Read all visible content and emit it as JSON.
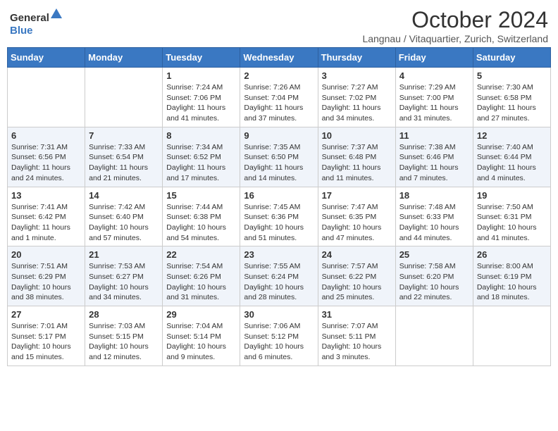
{
  "header": {
    "logo": {
      "general": "General",
      "blue": "Blue"
    },
    "title": "October 2024",
    "subtitle": "Langnau / Vitaquartier, Zurich, Switzerland"
  },
  "weekdays": [
    "Sunday",
    "Monday",
    "Tuesday",
    "Wednesday",
    "Thursday",
    "Friday",
    "Saturday"
  ],
  "weeks": [
    [
      null,
      null,
      {
        "day": "1",
        "sunrise": "Sunrise: 7:24 AM",
        "sunset": "Sunset: 7:06 PM",
        "daylight": "Daylight: 11 hours and 41 minutes."
      },
      {
        "day": "2",
        "sunrise": "Sunrise: 7:26 AM",
        "sunset": "Sunset: 7:04 PM",
        "daylight": "Daylight: 11 hours and 37 minutes."
      },
      {
        "day": "3",
        "sunrise": "Sunrise: 7:27 AM",
        "sunset": "Sunset: 7:02 PM",
        "daylight": "Daylight: 11 hours and 34 minutes."
      },
      {
        "day": "4",
        "sunrise": "Sunrise: 7:29 AM",
        "sunset": "Sunset: 7:00 PM",
        "daylight": "Daylight: 11 hours and 31 minutes."
      },
      {
        "day": "5",
        "sunrise": "Sunrise: 7:30 AM",
        "sunset": "Sunset: 6:58 PM",
        "daylight": "Daylight: 11 hours and 27 minutes."
      }
    ],
    [
      {
        "day": "6",
        "sunrise": "Sunrise: 7:31 AM",
        "sunset": "Sunset: 6:56 PM",
        "daylight": "Daylight: 11 hours and 24 minutes."
      },
      {
        "day": "7",
        "sunrise": "Sunrise: 7:33 AM",
        "sunset": "Sunset: 6:54 PM",
        "daylight": "Daylight: 11 hours and 21 minutes."
      },
      {
        "day": "8",
        "sunrise": "Sunrise: 7:34 AM",
        "sunset": "Sunset: 6:52 PM",
        "daylight": "Daylight: 11 hours and 17 minutes."
      },
      {
        "day": "9",
        "sunrise": "Sunrise: 7:35 AM",
        "sunset": "Sunset: 6:50 PM",
        "daylight": "Daylight: 11 hours and 14 minutes."
      },
      {
        "day": "10",
        "sunrise": "Sunrise: 7:37 AM",
        "sunset": "Sunset: 6:48 PM",
        "daylight": "Daylight: 11 hours and 11 minutes."
      },
      {
        "day": "11",
        "sunrise": "Sunrise: 7:38 AM",
        "sunset": "Sunset: 6:46 PM",
        "daylight": "Daylight: 11 hours and 7 minutes."
      },
      {
        "day": "12",
        "sunrise": "Sunrise: 7:40 AM",
        "sunset": "Sunset: 6:44 PM",
        "daylight": "Daylight: 11 hours and 4 minutes."
      }
    ],
    [
      {
        "day": "13",
        "sunrise": "Sunrise: 7:41 AM",
        "sunset": "Sunset: 6:42 PM",
        "daylight": "Daylight: 11 hours and 1 minute."
      },
      {
        "day": "14",
        "sunrise": "Sunrise: 7:42 AM",
        "sunset": "Sunset: 6:40 PM",
        "daylight": "Daylight: 10 hours and 57 minutes."
      },
      {
        "day": "15",
        "sunrise": "Sunrise: 7:44 AM",
        "sunset": "Sunset: 6:38 PM",
        "daylight": "Daylight: 10 hours and 54 minutes."
      },
      {
        "day": "16",
        "sunrise": "Sunrise: 7:45 AM",
        "sunset": "Sunset: 6:36 PM",
        "daylight": "Daylight: 10 hours and 51 minutes."
      },
      {
        "day": "17",
        "sunrise": "Sunrise: 7:47 AM",
        "sunset": "Sunset: 6:35 PM",
        "daylight": "Daylight: 10 hours and 47 minutes."
      },
      {
        "day": "18",
        "sunrise": "Sunrise: 7:48 AM",
        "sunset": "Sunset: 6:33 PM",
        "daylight": "Daylight: 10 hours and 44 minutes."
      },
      {
        "day": "19",
        "sunrise": "Sunrise: 7:50 AM",
        "sunset": "Sunset: 6:31 PM",
        "daylight": "Daylight: 10 hours and 41 minutes."
      }
    ],
    [
      {
        "day": "20",
        "sunrise": "Sunrise: 7:51 AM",
        "sunset": "Sunset: 6:29 PM",
        "daylight": "Daylight: 10 hours and 38 minutes."
      },
      {
        "day": "21",
        "sunrise": "Sunrise: 7:53 AM",
        "sunset": "Sunset: 6:27 PM",
        "daylight": "Daylight: 10 hours and 34 minutes."
      },
      {
        "day": "22",
        "sunrise": "Sunrise: 7:54 AM",
        "sunset": "Sunset: 6:26 PM",
        "daylight": "Daylight: 10 hours and 31 minutes."
      },
      {
        "day": "23",
        "sunrise": "Sunrise: 7:55 AM",
        "sunset": "Sunset: 6:24 PM",
        "daylight": "Daylight: 10 hours and 28 minutes."
      },
      {
        "day": "24",
        "sunrise": "Sunrise: 7:57 AM",
        "sunset": "Sunset: 6:22 PM",
        "daylight": "Daylight: 10 hours and 25 minutes."
      },
      {
        "day": "25",
        "sunrise": "Sunrise: 7:58 AM",
        "sunset": "Sunset: 6:20 PM",
        "daylight": "Daylight: 10 hours and 22 minutes."
      },
      {
        "day": "26",
        "sunrise": "Sunrise: 8:00 AM",
        "sunset": "Sunset: 6:19 PM",
        "daylight": "Daylight: 10 hours and 18 minutes."
      }
    ],
    [
      {
        "day": "27",
        "sunrise": "Sunrise: 7:01 AM",
        "sunset": "Sunset: 5:17 PM",
        "daylight": "Daylight: 10 hours and 15 minutes."
      },
      {
        "day": "28",
        "sunrise": "Sunrise: 7:03 AM",
        "sunset": "Sunset: 5:15 PM",
        "daylight": "Daylight: 10 hours and 12 minutes."
      },
      {
        "day": "29",
        "sunrise": "Sunrise: 7:04 AM",
        "sunset": "Sunset: 5:14 PM",
        "daylight": "Daylight: 10 hours and 9 minutes."
      },
      {
        "day": "30",
        "sunrise": "Sunrise: 7:06 AM",
        "sunset": "Sunset: 5:12 PM",
        "daylight": "Daylight: 10 hours and 6 minutes."
      },
      {
        "day": "31",
        "sunrise": "Sunrise: 7:07 AM",
        "sunset": "Sunset: 5:11 PM",
        "daylight": "Daylight: 10 hours and 3 minutes."
      },
      null,
      null
    ]
  ]
}
